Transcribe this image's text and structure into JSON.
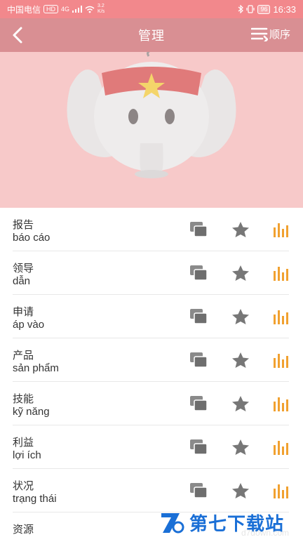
{
  "status": {
    "carrier": "中国电信",
    "hd": "HD",
    "net": "4G",
    "speed_value": "3.2",
    "speed_unit": "K/s",
    "battery": "96",
    "time": "16:33"
  },
  "header": {
    "title": "管理",
    "sort_label": "顺序"
  },
  "items": [
    {
      "zh": "报告",
      "vi": "báo cáo"
    },
    {
      "zh": "领导",
      "vi": "dẫn"
    },
    {
      "zh": "申请",
      "vi": "áp vào"
    },
    {
      "zh": "产品",
      "vi": "sản phẩm"
    },
    {
      "zh": "技能",
      "vi": "kỹ năng"
    },
    {
      "zh": "利益",
      "vi": "lợi ích"
    },
    {
      "zh": "状况",
      "vi": "trạng thái"
    },
    {
      "zh": "资源",
      "vi": ""
    }
  ],
  "watermark": {
    "text": "第七下载站",
    "small": "d7down.com"
  },
  "colors": {
    "statusbar": "#f2888c",
    "header": "#d98f93",
    "hero_bg": "#f7c9c9",
    "bars_icon": "#f1a130",
    "icon_gray": "#707070"
  },
  "icons": {
    "back": "back-arrow-icon",
    "sort": "sort-lines-icon",
    "copy": "copy-icon",
    "star": "star-icon",
    "bars": "audio-bars-icon"
  }
}
